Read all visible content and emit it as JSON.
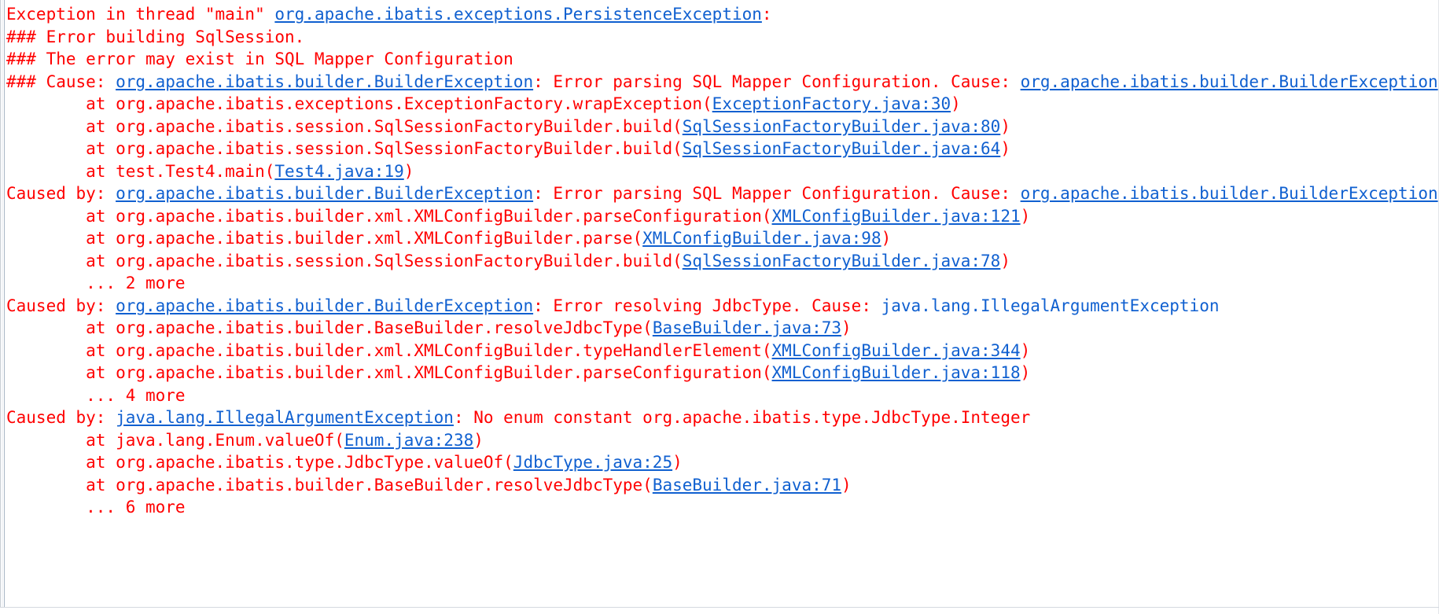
{
  "console": {
    "name": "java-stacktrace-console-output",
    "background_color": "#ffffff",
    "error_color": "#ff0000",
    "link_color": "#1060d0",
    "lines": [
      {
        "id": "line-1-exception-header",
        "segments": [
          {
            "type": "err",
            "text": "Exception in thread \"main\" "
          },
          {
            "type": "lnk",
            "text": "org.apache.ibatis.exceptions.PersistenceException"
          },
          {
            "type": "err",
            "text": ":"
          }
        ]
      },
      {
        "id": "line-2-error-building",
        "segments": [
          {
            "type": "err",
            "text": "### Error building SqlSession."
          }
        ]
      },
      {
        "id": "line-3-error-may-exist",
        "segments": [
          {
            "type": "err",
            "text": "### The error may exist in SQL Mapper Configuration"
          }
        ]
      },
      {
        "id": "line-4-cause",
        "segments": [
          {
            "type": "err",
            "text": "### Cause: "
          },
          {
            "type": "lnk",
            "text": "org.apache.ibatis.builder.BuilderException"
          },
          {
            "type": "err",
            "text": ": Error parsing SQL Mapper Configuration. Cause: "
          },
          {
            "type": "lnk",
            "text": "org.apache.ibatis.builder.BuilderException"
          }
        ]
      },
      {
        "id": "line-5-at-exceptionfactory",
        "segments": [
          {
            "type": "err",
            "text": "        at org.apache.ibatis.exceptions.ExceptionFactory.wrapException("
          },
          {
            "type": "lnk",
            "text": "ExceptionFactory.java:30"
          },
          {
            "type": "err",
            "text": ")"
          }
        ]
      },
      {
        "id": "line-6-at-sqlsessionfactorybuilder-80",
        "segments": [
          {
            "type": "err",
            "text": "        at org.apache.ibatis.session.SqlSessionFactoryBuilder.build("
          },
          {
            "type": "lnk",
            "text": "SqlSessionFactoryBuilder.java:80"
          },
          {
            "type": "err",
            "text": ")"
          }
        ]
      },
      {
        "id": "line-7-at-sqlsessionfactorybuilder-64",
        "segments": [
          {
            "type": "err",
            "text": "        at org.apache.ibatis.session.SqlSessionFactoryBuilder.build("
          },
          {
            "type": "lnk",
            "text": "SqlSessionFactoryBuilder.java:64"
          },
          {
            "type": "err",
            "text": ")"
          }
        ]
      },
      {
        "id": "line-8-at-test4-main",
        "segments": [
          {
            "type": "err",
            "text": "        at test.Test4.main("
          },
          {
            "type": "lnk",
            "text": "Test4.java:19"
          },
          {
            "type": "err",
            "text": ")"
          }
        ]
      },
      {
        "id": "line-9-caused-by-builderexception-1",
        "segments": [
          {
            "type": "err",
            "text": "Caused by: "
          },
          {
            "type": "lnk",
            "text": "org.apache.ibatis.builder.BuilderException"
          },
          {
            "type": "err",
            "text": ": Error parsing SQL Mapper Configuration. Cause: "
          },
          {
            "type": "lnk",
            "text": "org.apache.ibatis.builder.BuilderException"
          }
        ]
      },
      {
        "id": "line-10-at-xmlconfigbuilder-121",
        "segments": [
          {
            "type": "err",
            "text": "        at org.apache.ibatis.builder.xml.XMLConfigBuilder.parseConfiguration("
          },
          {
            "type": "lnk",
            "text": "XMLConfigBuilder.java:121"
          },
          {
            "type": "err",
            "text": ")"
          }
        ]
      },
      {
        "id": "line-11-at-xmlconfigbuilder-98",
        "segments": [
          {
            "type": "err",
            "text": "        at org.apache.ibatis.builder.xml.XMLConfigBuilder.parse("
          },
          {
            "type": "lnk",
            "text": "XMLConfigBuilder.java:98"
          },
          {
            "type": "err",
            "text": ")"
          }
        ]
      },
      {
        "id": "line-12-at-sqlsessionfactorybuilder-78",
        "segments": [
          {
            "type": "err",
            "text": "        at org.apache.ibatis.session.SqlSessionFactoryBuilder.build("
          },
          {
            "type": "lnk",
            "text": "SqlSessionFactoryBuilder.java:78"
          },
          {
            "type": "err",
            "text": ")"
          }
        ]
      },
      {
        "id": "line-13-2-more",
        "segments": [
          {
            "type": "err",
            "text": "        ... 2 more"
          }
        ]
      },
      {
        "id": "line-14-caused-by-builderexception-2",
        "segments": [
          {
            "type": "err",
            "text": "Caused by: "
          },
          {
            "type": "lnk",
            "text": "org.apache.ibatis.builder.BuilderException"
          },
          {
            "type": "err",
            "text": ": Error resolving JdbcType. Cause: "
          },
          {
            "type": "lnk-plain",
            "text": "java.lang.IllegalArgumentException"
          }
        ]
      },
      {
        "id": "line-15-at-basebuilder-73",
        "segments": [
          {
            "type": "err",
            "text": "        at org.apache.ibatis.builder.BaseBuilder.resolveJdbcType("
          },
          {
            "type": "lnk",
            "text": "BaseBuilder.java:73"
          },
          {
            "type": "err",
            "text": ")"
          }
        ]
      },
      {
        "id": "line-16-at-xmlconfigbuilder-344",
        "segments": [
          {
            "type": "err",
            "text": "        at org.apache.ibatis.builder.xml.XMLConfigBuilder.typeHandlerElement("
          },
          {
            "type": "lnk",
            "text": "XMLConfigBuilder.java:344"
          },
          {
            "type": "err",
            "text": ")"
          }
        ]
      },
      {
        "id": "line-17-at-xmlconfigbuilder-118",
        "segments": [
          {
            "type": "err",
            "text": "        at org.apache.ibatis.builder.xml.XMLConfigBuilder.parseConfiguration("
          },
          {
            "type": "lnk",
            "text": "XMLConfigBuilder.java:118"
          },
          {
            "type": "err",
            "text": ")"
          }
        ]
      },
      {
        "id": "line-18-4-more",
        "segments": [
          {
            "type": "err",
            "text": "        ... 4 more"
          }
        ]
      },
      {
        "id": "line-19-caused-by-illegalargument",
        "segments": [
          {
            "type": "err",
            "text": "Caused by: "
          },
          {
            "type": "lnk",
            "text": "java.lang.IllegalArgumentException"
          },
          {
            "type": "err",
            "text": ": No enum constant org.apache.ibatis.type.JdbcType.Integer"
          }
        ]
      },
      {
        "id": "line-20-at-enum-valueof",
        "segments": [
          {
            "type": "err",
            "text": "        at java.lang.Enum.valueOf("
          },
          {
            "type": "lnk",
            "text": "Enum.java:238"
          },
          {
            "type": "err",
            "text": ")"
          }
        ]
      },
      {
        "id": "line-21-at-jdbctype-valueof",
        "segments": [
          {
            "type": "err",
            "text": "        at org.apache.ibatis.type.JdbcType.valueOf("
          },
          {
            "type": "lnk",
            "text": "JdbcType.java:25"
          },
          {
            "type": "err",
            "text": ")"
          }
        ]
      },
      {
        "id": "line-22-at-basebuilder-71",
        "segments": [
          {
            "type": "err",
            "text": "        at org.apache.ibatis.builder.BaseBuilder.resolveJdbcType("
          },
          {
            "type": "lnk",
            "text": "BaseBuilder.java:71"
          },
          {
            "type": "err",
            "text": ")"
          }
        ]
      },
      {
        "id": "line-23-6-more",
        "segments": [
          {
            "type": "err",
            "text": "        ... 6 more"
          }
        ]
      }
    ]
  }
}
